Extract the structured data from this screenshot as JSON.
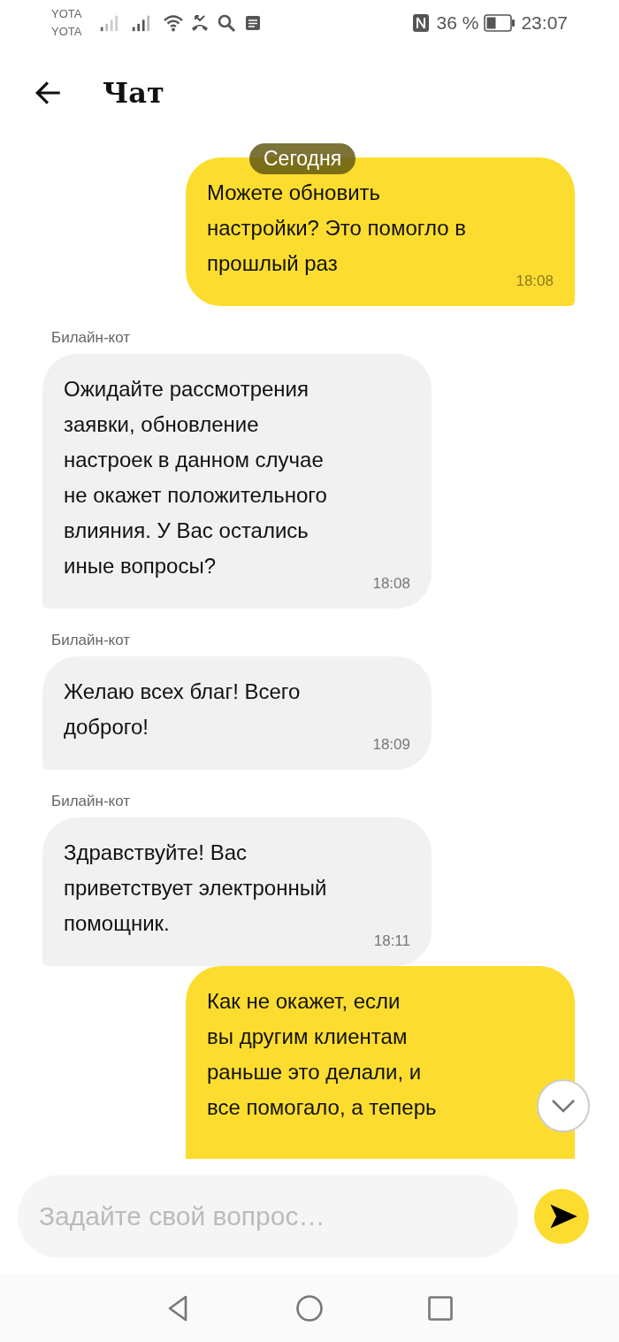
{
  "status_bar": {
    "carriers": [
      "YOTA",
      "YOTA"
    ],
    "battery_percent": "36 %",
    "time": "23:07"
  },
  "header": {
    "title": "Чат"
  },
  "date_chip": "Сегодня",
  "messages": [
    {
      "kind": "outgoing",
      "text": "Можете обновить\nнастройки? Это помогло в\nпрошлый раз",
      "time": "18:08"
    },
    {
      "kind": "incoming",
      "sender": "Билайн-кот",
      "text": "Ожидайте рассмотрения\nзаявки, обновление\nнастроек в данном случае\nне окажет положительного\nвлияния. У Вас остались\nиные вопросы?",
      "time": "18:08"
    },
    {
      "kind": "incoming",
      "sender": "Билайн-кот",
      "text": "Желаю всех благ! Всего\nдоброго!",
      "time": "18:09"
    },
    {
      "kind": "incoming",
      "sender": "Билайн-кот",
      "text": "Здравствуйте! Вас\nприветствует электронный\nпомощник.",
      "time": "18:11"
    },
    {
      "kind": "outgoing",
      "text": "Как не окажет, если\nвы другим клиентам\nраньше это делали, и\nвсе помогало, а теперь"
    }
  ],
  "composer": {
    "placeholder": "Задайте свой вопрос…"
  }
}
